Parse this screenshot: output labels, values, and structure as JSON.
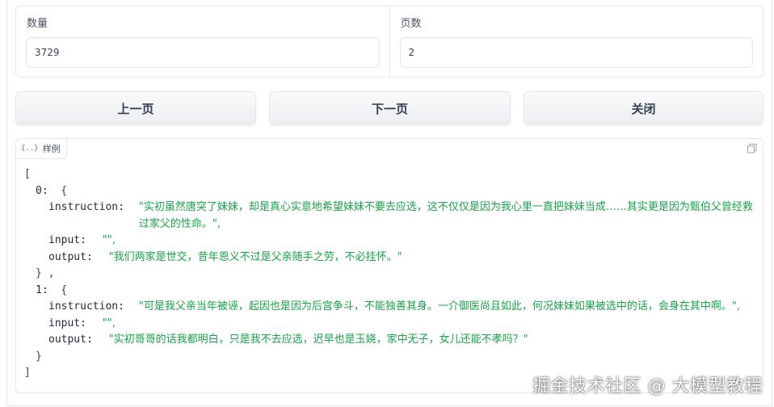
{
  "fields": {
    "count": {
      "label": "数量",
      "value": "3729"
    },
    "page": {
      "label": "页数",
      "value": "2"
    }
  },
  "buttons": {
    "prev": "上一页",
    "next": "下一页",
    "close": "关闭"
  },
  "json_panel": {
    "tab_icon": "{..}",
    "tab_label": "样例",
    "open_bracket": "[",
    "close_bracket": "]",
    "items": [
      {
        "index": "0:",
        "instruction": "\"实初虽然唐突了妹妹，却是真心实意地希望妹妹不要去应选，这不仅仅是因为我心里一直把妹妹当成……其实更是因为甄伯父曾经救过家父的性命。\",",
        "input": "\"\",",
        "output": "\"我们两家是世交，昔年恩义不过是父亲随手之劳，不必挂怀。\"",
        "close": "} ,"
      },
      {
        "index": "1:",
        "instruction": "\"可是我父亲当年被诬，起因也是因为后宫争斗，不能独善其身。一介御医尚且如此，何况妹妹如果被选中的话，会身在其中啊。\",",
        "input": "\"\",",
        "output": "\"实初哥哥的话我都明白，只是我不去应选，迟早也是玉娆，家中无子，女儿还能不孝吗？\"",
        "close": "}"
      }
    ],
    "keys": {
      "instruction": "instruction:",
      "input": "input:",
      "output": "output:"
    }
  },
  "watermark": "掘金技术社区 @ 大模型教程",
  "colors": {
    "string": "#16a34a",
    "border": "#e5e7eb"
  }
}
